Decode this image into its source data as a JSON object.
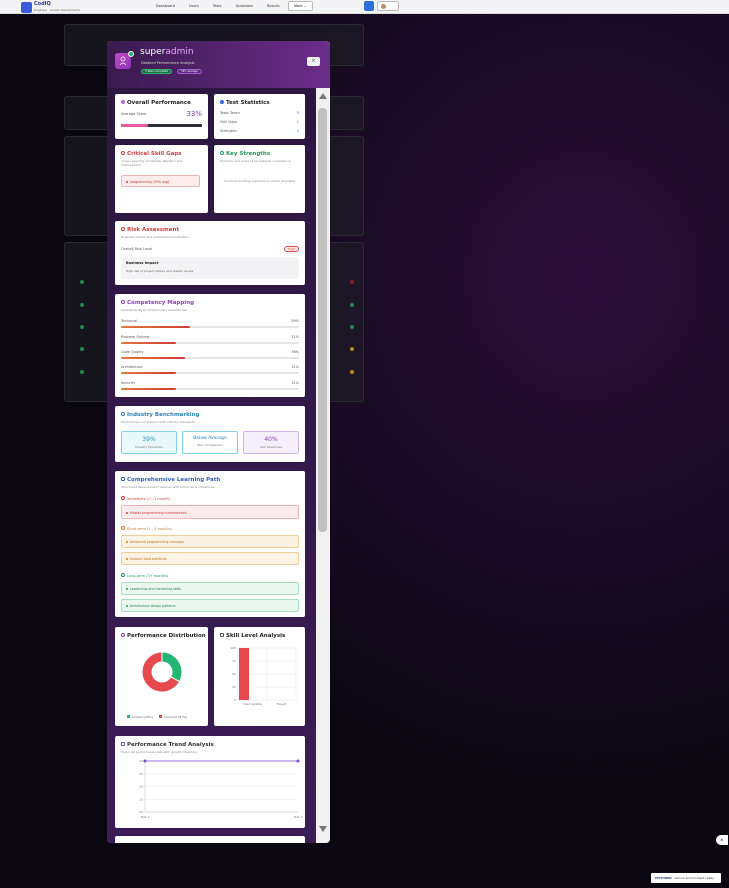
{
  "nav": {
    "brand_title": "CodIQ",
    "brand_sub": "Engineer · Grade Assessments",
    "links": [
      "Dashboard",
      "Users",
      "Tests",
      "Questions",
      "Results"
    ],
    "more_label": "More ⌄"
  },
  "modal": {
    "name_prefix": "super",
    "name_highlight": "admin",
    "subtitle": "Detailed Performance Analysis",
    "tag_tests": "3 Tests Completed",
    "tag_avg": "33% Average",
    "close_label": "×"
  },
  "overall": {
    "title": "Overall Performance",
    "avg_label": "Average Score",
    "avg_value": "33%",
    "avg_fraction": 0.33
  },
  "test_stats": {
    "title": "Test Statistics",
    "rows": [
      {
        "label": "Tests Taken",
        "value": "3"
      },
      {
        "label": "Skill Gaps",
        "value": "1"
      },
      {
        "label": "Strengths",
        "value": "0"
      }
    ]
  },
  "gaps": {
    "title": "Critical Skill Gaps",
    "subtitle": "Areas requiring immediate attention and improvement",
    "item": "programming (33% avg)"
  },
  "strengths": {
    "title": "Key Strengths",
    "subtitle": "Domains and areas of exceptional competence",
    "empty": "Continue building expertise to unlock strengths"
  },
  "risk": {
    "title": "Risk Assessment",
    "subtitle": "Business impact and performance evaluation",
    "level_label": "Overall Risk Level",
    "level_value": "High",
    "impact_title": "Business Impact",
    "impact_text": "High risk of project delays and quality issues"
  },
  "competency": {
    "title": "Competency Mapping",
    "subtitle": "Detailed analysis of technical competencies",
    "items": [
      {
        "label": "Technical",
        "value": "39%",
        "fraction": 0.39
      },
      {
        "label": "Problem Solving",
        "value": "31%",
        "fraction": 0.31
      },
      {
        "label": "Code Quality",
        "value": "36%",
        "fraction": 0.36
      },
      {
        "label": "Architecture",
        "value": "31%",
        "fraction": 0.31
      },
      {
        "label": "Security",
        "value": "31%",
        "fraction": 0.31
      }
    ]
  },
  "benchmark": {
    "title": "Industry Benchmarking",
    "subtitle": "Performance comparison with industry standards",
    "stats": [
      {
        "big": "39%",
        "small": "Industry Percentile"
      },
      {
        "big": "Below Average",
        "small": "Peer Comparison"
      },
      {
        "big": "40%",
        "small": "Skill Readiness"
      }
    ]
  },
  "learning": {
    "title": "Comprehensive Learning Path",
    "subtitle": "Structured development roadmap with timelines & milestones",
    "phases": [
      {
        "label": "Immediate (0 - 1 month)",
        "items": [
          "Master programming fundamentals"
        ]
      },
      {
        "label": "Short-term (1 - 3 months)",
        "items": [
          "Advanced programming concepts",
          "Industry best practices"
        ]
      },
      {
        "label": "Long-term (3+ months)",
        "items": [
          "Leadership and mentoring skills",
          "Architecture design patterns"
        ]
      }
    ]
  },
  "distribution": {
    "title": "Performance Distribution",
    "legend": [
      "Correct (33%)",
      "Incorrect (67%)"
    ]
  },
  "skill_level": {
    "title": "Skill Level Analysis",
    "y_ticks": [
      "100",
      "75",
      "50",
      "25",
      "0"
    ],
    "x_ticks": [
      "Intermediate",
      "Expert"
    ]
  },
  "trend": {
    "title": "Performance Trend Analysis",
    "subtitle": "Historical performance data with growth trajectory",
    "y_ticks": [
      "34",
      "33",
      "33",
      "33",
      "33"
    ],
    "x_ticks": [
      "Test 1",
      "Test 3"
    ]
  },
  "footer": {
    "fab": "⊕",
    "badge_brand": "MYTOKEN",
    "badge_text": " · secure environment ready"
  },
  "chart_data": [
    {
      "type": "pie",
      "categories": [
        "Correct",
        "Incorrect"
      ],
      "values": [
        33,
        67
      ],
      "colors": [
        "#22b573",
        "#e5484d"
      ]
    },
    {
      "type": "bar",
      "categories": [
        "Intermediate",
        "Expert"
      ],
      "values": [
        100,
        0
      ],
      "ylim": [
        0,
        100
      ],
      "grid": true,
      "colors": [
        "#e5484d"
      ]
    },
    {
      "type": "line",
      "x": [
        "Test 1",
        "Test 2",
        "Test 3"
      ],
      "values": [
        33,
        33,
        33
      ],
      "grid": true,
      "colors": [
        "#7b4fd6"
      ]
    }
  ]
}
